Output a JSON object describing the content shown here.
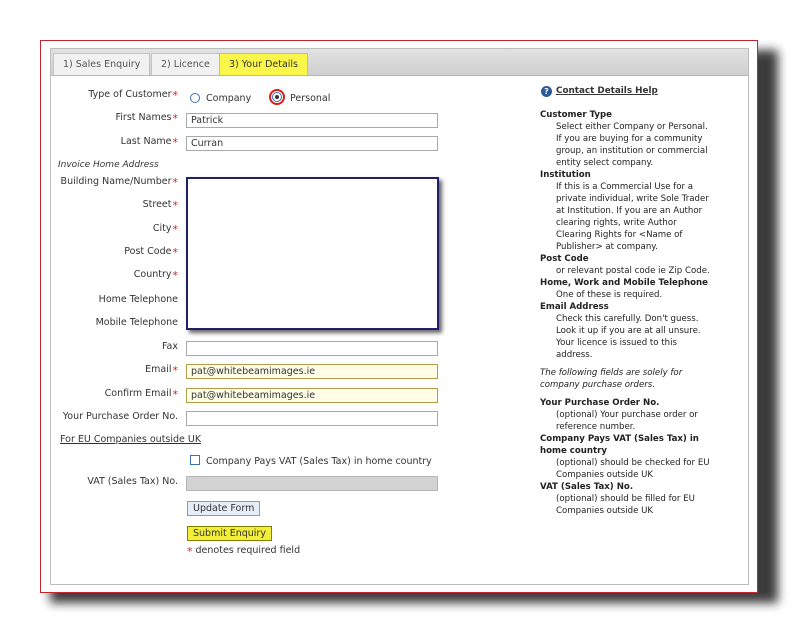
{
  "tabs": [
    {
      "label": "1) Sales Enquiry",
      "active": false
    },
    {
      "label": "2) Licence",
      "active": false
    },
    {
      "label": "3) Your Details",
      "active": true
    }
  ],
  "form": {
    "customer_type_label": "Type of Customer",
    "option_company": "Company",
    "option_personal": "Personal",
    "selected_customer_type": "Personal",
    "first_names_label": "First Names",
    "first_names_value": "Patrick",
    "last_name_label": "Last Name",
    "last_name_value": "Curran",
    "invoice_section": "Invoice Home Address",
    "building_label": "Building Name/Number",
    "street_label": "Street",
    "city_label": "City",
    "post_code_label": "Post Code",
    "country_label": "Country",
    "home_tel_label": "Home Telephone",
    "mobile_tel_label": "Mobile Telephone",
    "fax_label": "Fax",
    "email_label": "Email",
    "email_value": "pat@whitebeamimages.ie",
    "confirm_email_label": "Confirm Email",
    "confirm_email_value": "pat@whitebeamimages.ie",
    "po_label": "Your Purchase Order No.",
    "eu_link": "For EU Companies outside UK",
    "vat_checkbox_label": "Company Pays VAT (Sales Tax) in home country",
    "vat_label": "VAT (Sales Tax) No.",
    "update_button": "Update Form",
    "submit_button": "Submit Enquiry",
    "required_note": "denotes required field",
    "required_mark": "*"
  },
  "help": {
    "title": "Contact Details Help",
    "customer_type_head": "Customer Type",
    "customer_type_body": "Select either Company or Personal. If you are buying for a community group, an institution or commercial entity select company.",
    "institution_head": "Institution",
    "institution_body": "If this is a Commercial Use for a private individual, write Sole Trader at Institution. If you are an Author clearing rights, write Author Clearing Rights for <Name of Publisher> at company.",
    "post_code_head": "Post Code",
    "post_code_body": "or relevant postal code ie Zip Code.",
    "phone_head": "Home, Work and Mobile Telephone",
    "phone_body": "One of these is required.",
    "email_head": "Email Address",
    "email_body": "Check this carefully. Don't guess. Look it up if you are at all unsure. Your licence is issued to this address.",
    "po_note": "The following fields are solely for company purchase orders.",
    "po_head": "Your Purchase Order No.",
    "po_body": "(optional) Your purchase order or reference number.",
    "vat_pays_head": "Company Pays VAT (Sales Tax) in home country",
    "vat_pays_body": "(optional) should be checked for EU Companies outside UK",
    "vat_no_head": "VAT (Sales Tax) No.",
    "vat_no_body": "(optional) should be filled for EU Companies outside UK"
  },
  "colors": {
    "active_tab": "#fbf74a",
    "required": "#d91e18",
    "frame_border": "#c0272d",
    "submit": "#f2ee3a"
  }
}
